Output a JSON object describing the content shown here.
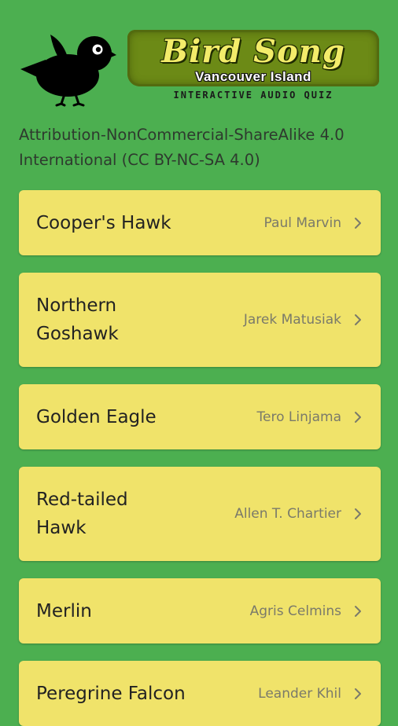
{
  "header": {
    "title": "Bird Song",
    "subtitle": "Vancouver Island",
    "tagline": "INTERACTIVE AUDIO QUIZ",
    "logo_icon": "black-bird-icon"
  },
  "license_text": "Attribution-NonCommercial-ShareAlike 4.0 International (CC BY-NC-SA 4.0)",
  "colors": {
    "background": "#4caf50",
    "card": "#f0e36a",
    "title_box": "#6c8a16",
    "title_text": "#f3ec6a"
  },
  "birds": [
    {
      "name": "Cooper's Hawk",
      "credit": "Paul Marvin",
      "icon": "chevron-right-icon"
    },
    {
      "name": "Northern Goshawk",
      "credit": "Jarek Matusiak",
      "icon": "chevron-right-icon"
    },
    {
      "name": "Golden Eagle",
      "credit": "Tero Linjama",
      "icon": "chevron-right-icon"
    },
    {
      "name": "Red-tailed Hawk",
      "credit": "Allen T. Chartier",
      "icon": "chevron-right-icon"
    },
    {
      "name": "Merlin",
      "credit": "Agris Celmins",
      "icon": "chevron-right-icon"
    },
    {
      "name": "Peregrine Falcon",
      "credit": "Leander Khil",
      "icon": "chevron-right-icon"
    }
  ]
}
